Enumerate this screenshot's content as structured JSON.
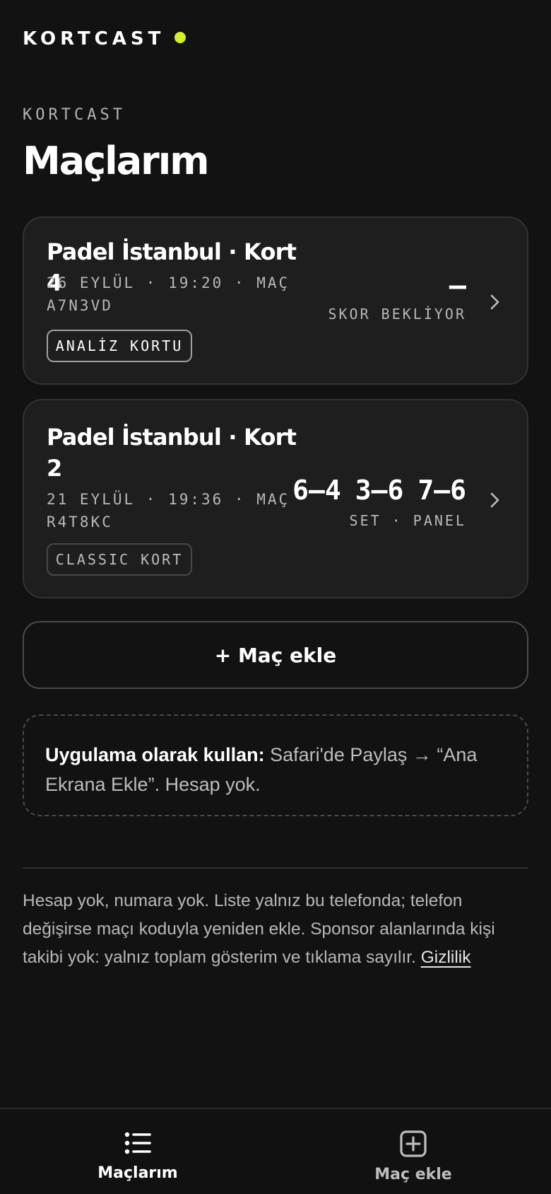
{
  "header": {
    "brand": "KORTCAST",
    "accent_color": "#d6f11c"
  },
  "page": {
    "eyebrow": "KORTCAST",
    "title": "Maçlarım"
  },
  "matches": [
    {
      "title": "Padel İstanbul · Kort 4",
      "meta": "26 EYLÜL · 19:20 · MAÇ A7N3VD",
      "tag": "ANALİZ KORTU",
      "score": "–",
      "status": "SKOR BEKLİYOR"
    },
    {
      "title": "Padel İstanbul · Kort 2",
      "meta": "21 EYLÜL · 19:36 · MAÇ R4T8KC",
      "tag": "CLASSIC KORT",
      "sets": [
        "6–4",
        "3–6",
        "7–6"
      ],
      "status": "SET · PANEL"
    }
  ],
  "actions": {
    "add_match": "+ Maç ekle"
  },
  "tip": {
    "bold": "Uygulama olarak kullan:",
    "text": "Safari'de Paylaş → “Ana Ekrana Ekle”. Hesap yok."
  },
  "footer": {
    "text": "Hesap yok, numara yok. Liste yalnız bu telefonda; telefon değişirse maçı koduyla yeniden ekle. Sponsor alanlarında kişi takibi yok: yalnız toplam gösterim ve tıklama sayılır.",
    "link": "Gizlilik"
  },
  "tabbar": {
    "tabs": [
      {
        "label": "Maçlarım",
        "icon": "list-icon",
        "active": true
      },
      {
        "label": "Maç ekle",
        "icon": "plus-square-icon",
        "active": false
      }
    ]
  }
}
